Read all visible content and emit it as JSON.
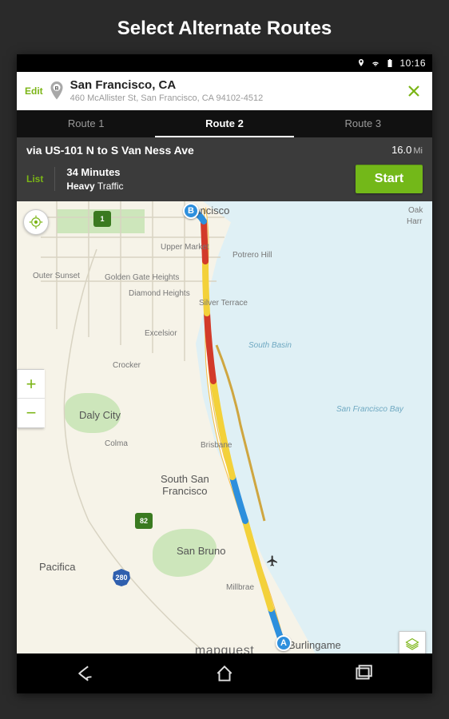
{
  "page_title": "Select Alternate Routes",
  "statusbar": {
    "time": "10:16"
  },
  "destination": {
    "edit_label": "Edit",
    "pin_letter": "B",
    "city": "San Francisco, CA",
    "address": "460 McAllister St, San Francisco, CA 94102-4512"
  },
  "tabs": [
    {
      "label": "Route 1",
      "active": false
    },
    {
      "label": "Route 2",
      "active": true
    },
    {
      "label": "Route 3",
      "active": false
    }
  ],
  "summary": {
    "via": "via US-101 N to S Van Ness Ave",
    "distance_value": "16.0",
    "distance_unit": "Mi",
    "list_label": "List",
    "minutes": "34 Minutes",
    "traffic_heavy": "Heavy",
    "traffic_suffix": " Traffic",
    "start_label": "Start"
  },
  "map": {
    "brand": "mapquest",
    "marker_a": "A",
    "marker_b": "B",
    "zoom_in": "+",
    "zoom_out": "−",
    "shields": {
      "us1": "1",
      "us82": "82",
      "i280": "280"
    },
    "labels": {
      "sf": "Francisco",
      "upper_market": "Upper Market",
      "potrero": "Potrero Hill",
      "outer_sunset": "Outer Sunset",
      "ggh": "Golden Gate Heights",
      "diamond": "Diamond Heights",
      "silver": "Silver Terrace",
      "excelsior": "Excelsior",
      "crocker": "Crocker",
      "south_basin": "South Basin",
      "daly": "Daly City",
      "colma": "Colma",
      "brisbane": "Brisbane",
      "ssf": "South San\nFrancisco",
      "san_bruno": "San Bruno",
      "millbrae": "Millbrae",
      "pacifica": "Pacifica",
      "burlingame": "Burlingame",
      "sfbay": "San Francisco Bay",
      "oak": "Oak",
      "harr": "Harr"
    }
  }
}
